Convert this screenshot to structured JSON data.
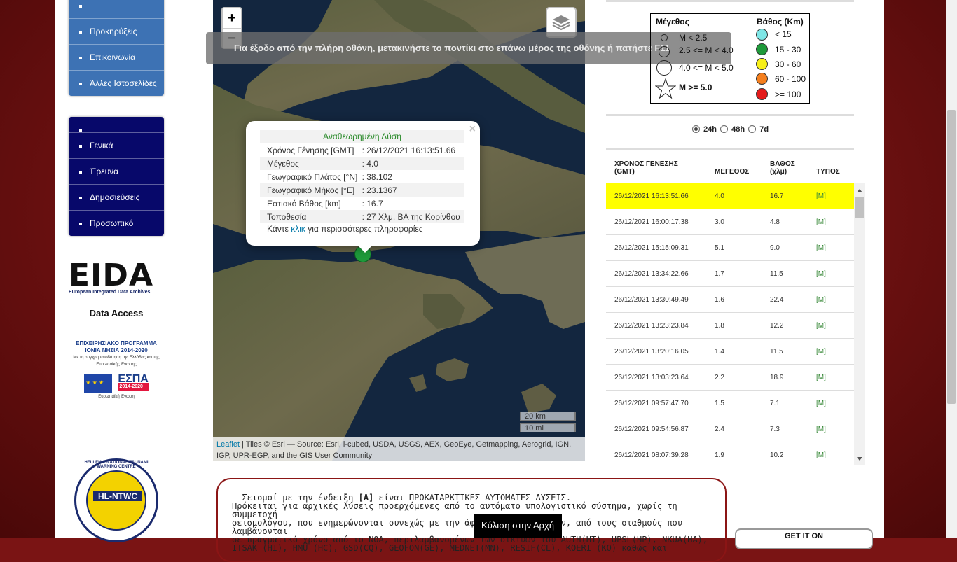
{
  "sidebar": {
    "menu1": [
      "Προκηρύξεις",
      "Επικοινωνία",
      "Άλλες Ιστοσελίδες"
    ],
    "menu2": [
      "Γενικά",
      "Έρευνα",
      "Δημοσιεύσεις",
      "Προσωπικό"
    ],
    "eida_logo": "EIDA",
    "eida_sub": "European Integrated Data Archives",
    "data_access": "Data Access",
    "espa_line1": "ΕΠΙΧΕΙΡΗΣΙΑΚΟ ΠΡΟΓΡΑΜΜΑ",
    "espa_line2": "ΙΟΝΙΑ ΝΗΣΙΑ 2014-2020",
    "espa_line3": "Με τη συγχρηματοδότηση της Ελλάδας και της Ευρωπαϊκής Ένωσης",
    "espa_eu": "Ευρωπαϊκή Ένωση",
    "espa_name": "ΕΣΠΑ",
    "espa_years": "2014-2020",
    "ntwc_text": "HL-NTWC",
    "ntwc_ring": "HELLENIC NATIONAL TSUNAMI WARNING CENTRE"
  },
  "map": {
    "zoom_in": "+",
    "zoom_out": "−",
    "fullscreen_msg": "Για έξοδο από την πλήρη οθόνη, μετακινήστε το ποντίκι στο επάνω μέρος της οθόνης ή πατήστε  F11",
    "popup": {
      "title": "Αναθεωρημένη Λύση",
      "rows": [
        {
          "label": "Χρόνος Γένησης [GMT]",
          "value": ": 26/12/2021 16:13:51.66"
        },
        {
          "label": "Μέγεθος",
          "value": ": 4.0"
        },
        {
          "label": "Γεωγραφικό Πλάτος [°N]",
          "value": ": 38.102"
        },
        {
          "label": "Γεωγραφικό Μήκος [°E]",
          "value": ": 23.1367"
        },
        {
          "label": "Εστιακό Βάθος [km]",
          "value": ": 16.7"
        },
        {
          "label": "Τοποθεσία",
          "value": ": 27 Χλμ. ΒΑ της Κορίνθου"
        }
      ],
      "more_prefix": "Κάντε",
      "more_link": "κλικ",
      "more_suffix": "για περισσότερες πληροφορίες"
    },
    "scale_km": "20 km",
    "scale_mi": "10 mi",
    "attrib_link": "Leaflet",
    "attrib_text": " | Tiles © Esri — Source: Esri, i-cubed, USDA, USGS, AEX, GeoEye, Getmapping, Aerogrid, IGN, IGP, UPR-EGP, and the GIS User Community"
  },
  "legend": {
    "mag_title": "Μέγεθος",
    "depth_title": "Βάθος (Km)",
    "mags": [
      "M < 2.5",
      "2.5 <= M < 4.0",
      "4.0 <= M < 5.0",
      "M >= 5.0"
    ],
    "depths": [
      {
        "label": "< 15",
        "color": "#7fe6e6"
      },
      {
        "label": "15 - 30",
        "color": "#1e9a3a"
      },
      {
        "label": "30 - 60",
        "color": "#f7ef1a"
      },
      {
        "label": "60 - 100",
        "color": "#f57f1e"
      },
      {
        "label": ">= 100",
        "color": "#e31b1b"
      }
    ]
  },
  "period": {
    "options": [
      "24h",
      "48h",
      "7d"
    ],
    "selected": "24h"
  },
  "quakes": {
    "headers": {
      "time": "ΧΡΟΝΟΣ ΓΕΝΕΣΗΣ (GMT)",
      "mag": "ΜΕΓΕΘΟΣ",
      "depth": "ΒΑΘΟΣ (χλμ)",
      "type": "ΤΥΠΟΣ"
    },
    "rows": [
      {
        "time": "26/12/2021 16:13:51.66",
        "mag": "4.0",
        "depth": "16.7",
        "type": "[M]"
      },
      {
        "time": "26/12/2021 16:00:17.38",
        "mag": "3.0",
        "depth": "4.8",
        "type": "[M]"
      },
      {
        "time": "26/12/2021 15:15:09.31",
        "mag": "5.1",
        "depth": "9.0",
        "type": "[M]"
      },
      {
        "time": "26/12/2021 13:34:22.66",
        "mag": "1.7",
        "depth": "11.5",
        "type": "[M]"
      },
      {
        "time": "26/12/2021 13:30:49.49",
        "mag": "1.6",
        "depth": "22.4",
        "type": "[M]"
      },
      {
        "time": "26/12/2021 13:23:23.84",
        "mag": "1.8",
        "depth": "12.2",
        "type": "[M]"
      },
      {
        "time": "26/12/2021 13:20:16.05",
        "mag": "1.4",
        "depth": "11.5",
        "type": "[M]"
      },
      {
        "time": "26/12/2021 13:03:23.64",
        "mag": "2.2",
        "depth": "18.9",
        "type": "[M]"
      },
      {
        "time": "26/12/2021 09:57:47.70",
        "mag": "1.5",
        "depth": "7.1",
        "type": "[M]"
      },
      {
        "time": "26/12/2021 09:54:56.87",
        "mag": "2.4",
        "depth": "7.3",
        "type": "[M]"
      },
      {
        "time": "26/12/2021 08:07:39.28",
        "mag": "1.9",
        "depth": "10.2",
        "type": "[M]"
      }
    ]
  },
  "notice": {
    "line1_pre": "- Σεισμοί με την ένδειξη",
    "line1_tag": "[A]",
    "line1_post": "είναι ΠΡΟΚΑΤΑΡΚΤΙΚΕΣ ΑΥΤΟΜΑΤΕΣ ΛΥΣΕΙΣ.",
    "line2": "Πρόκειται για αρχικές λύσεις προερχόμενες από το αυτόματο υπολογιστικό σύστημα, χωρίς τη συμμετοχή",
    "line3": "σεισμολόγου, που ενημερώνονται συνεχώς με την άφιξη νέων δεδομένων, από τους σταθμούς που λαμβάνονται",
    "line4": "σε πραγματικό χρόνο από το NOA, περιλαμβανομένων των δικτύων του AUTH(HT), UPSL(HP), NKUA(HA),",
    "line5": "ITSAK (HI), HMU (HC), GSD(CQ), GEOFON(GE), MEDNET(MN), RESIF(CL), KOERI (KO) καθώς και"
  },
  "scroll_top": "Κύλιση στην Αρχή",
  "get_it": "GET IT ON"
}
